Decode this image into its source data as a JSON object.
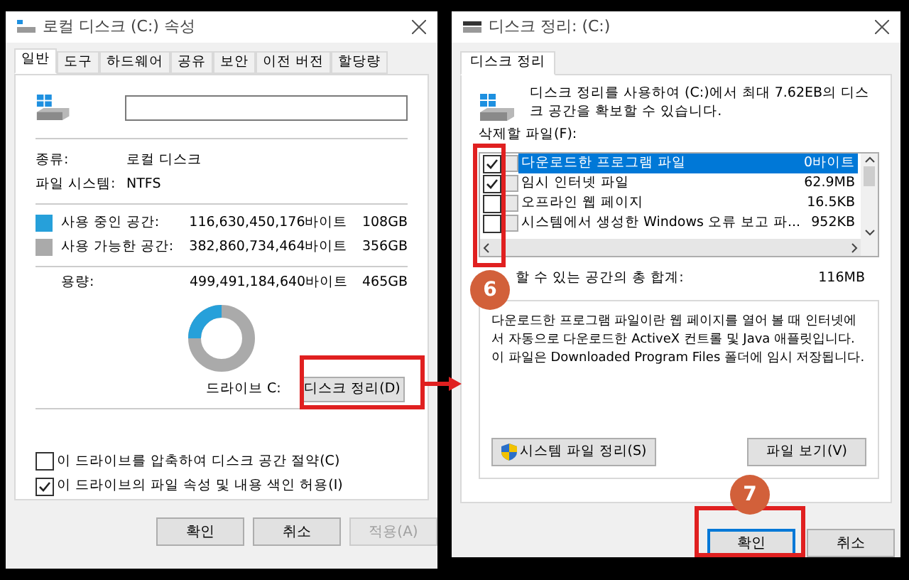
{
  "properties_window": {
    "title": "로컬 디스크 (C:) 속성",
    "tabs": [
      {
        "label": "일반",
        "selected": true
      },
      {
        "label": "도구",
        "selected": false
      },
      {
        "label": "하드웨어",
        "selected": false
      },
      {
        "label": "공유",
        "selected": false
      },
      {
        "label": "보안",
        "selected": false
      },
      {
        "label": "이전 버전",
        "selected": false
      },
      {
        "label": "할당량",
        "selected": false
      }
    ],
    "info": [
      {
        "label": "종류:",
        "value": "로컬 디스크"
      },
      {
        "label": "파일 시스템:",
        "value": "NTFS"
      }
    ],
    "space": [
      {
        "label": "사용 중인 공간:",
        "bytes": "116,630,450,176바이트",
        "size": "108GB",
        "color": "#26a0da"
      },
      {
        "label": "사용 가능한 공간:",
        "bytes": "382,860,734,464바이트",
        "size": "356GB",
        "color": "#aaaaaa"
      }
    ],
    "capacity": {
      "label": "용량:",
      "bytes": "499,491,184,640바이트",
      "size": "465GB"
    },
    "drive_label": "드라이브 C:",
    "cleanup_button": "디스크 정리(D)",
    "options": [
      {
        "label": "이 드라이브를 압축하여 디스크 공간 절약(C)",
        "checked": false
      },
      {
        "label": "이 드라이브의 파일 속성 및 내용 색인 허용(I)",
        "checked": true
      }
    ],
    "buttons": [
      {
        "label": "확인",
        "disabled": false
      },
      {
        "label": "취소",
        "disabled": false
      },
      {
        "label": "적용(A)",
        "disabled": true
      }
    ]
  },
  "cleanup_window": {
    "title": "디스크 정리: (C:)",
    "tab": "디스크 정리",
    "intro": "디스크 정리를 사용하여 (C:)에서 최대 7.62EB의 디스크 공간을 확보할 수 있습니다.",
    "files_label": "삭제할 파일(F):",
    "files": [
      {
        "name": "다운로드한 프로그램 파일",
        "size": "0바이트",
        "checked": true,
        "selected": true
      },
      {
        "name": "임시 인터넷 파일",
        "size": "62.9MB",
        "checked": true,
        "selected": false
      },
      {
        "name": "오프라인 웹 페이지",
        "size": "16.5KB",
        "checked": false,
        "selected": false
      },
      {
        "name": "시스템에서 생성한 Windows 오류 보고 파...",
        "size": "952KB",
        "checked": false,
        "selected": false
      }
    ],
    "total_label": "할 수 있는 공간의 총 합계:",
    "total": "116MB",
    "description": "다운로드한 프로그램 파일이란 웹 페이지를 열어 볼 때 인터넷에서 자동으로 다운로드한 ActiveX 컨트롤 및 Java 애플릿입니다. 이 파일은 Downloaded Program Files 폴더에 임시 저장됩니다.",
    "system_button": "시스템 파일 정리(S)",
    "view_button": "파일 보기(V)",
    "buttons": [
      {
        "label": "확인",
        "default": true
      },
      {
        "label": "취소",
        "default": false
      }
    ]
  },
  "annotations": [
    {
      "label": "6"
    },
    {
      "label": "7"
    }
  ]
}
